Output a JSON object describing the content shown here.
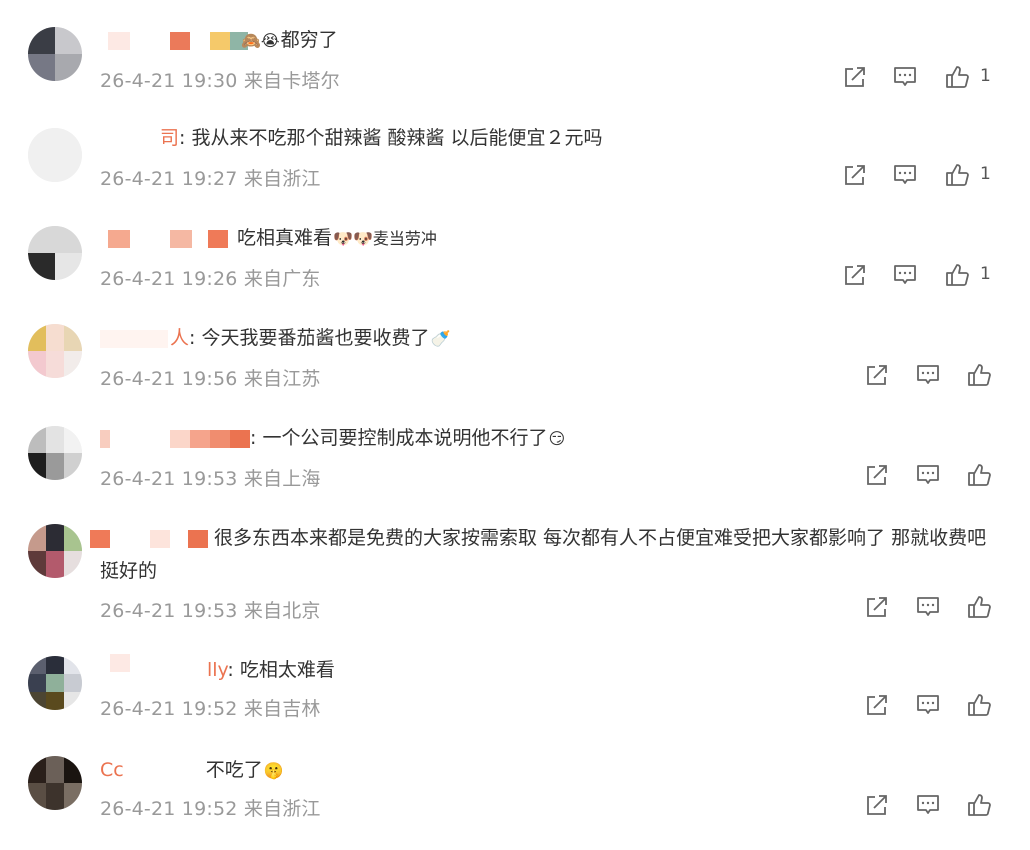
{
  "comments": [
    {
      "username": "",
      "text": "都穷了",
      "emoji_before": "🙈😭",
      "emoji_after": "",
      "time": "26-4-21 19:30",
      "location": "来自卡塔尔",
      "likes": "1"
    },
    {
      "username": "司",
      "text": "我从来不吃那个甜辣酱 酸辣酱 以后能便宜２元吗",
      "emoji_before": "",
      "emoji_after": "",
      "time": "26-4-21 19:27",
      "location": "来自浙江",
      "likes": "1"
    },
    {
      "username": "",
      "text": "吃相真难看",
      "emoji_before": "",
      "emoji_after": "🐶🐶麦当劳冲",
      "time": "26-4-21 19:26",
      "location": "来自广东",
      "likes": "1"
    },
    {
      "username": "人",
      "text": "今天我要番茄酱也要收费了",
      "emoji_before": "",
      "emoji_after": "🍼",
      "time": "26-4-21 19:56",
      "location": "来自江苏",
      "likes": ""
    },
    {
      "username": "",
      "text": "一个公司要控制成本说明他不行了",
      "emoji_before": "",
      "emoji_after": "😏",
      "time": "26-4-21 19:53",
      "location": "来自上海",
      "likes": ""
    },
    {
      "username": "",
      "text": "很多东西本来都是免费的大家按需索取 每次都有人不占便宜难受把大家都影响了 那就收费吧 挺好的",
      "emoji_before": "",
      "emoji_after": "",
      "time": "26-4-21 19:53",
      "location": "来自北京",
      "likes": ""
    },
    {
      "username": "lly",
      "text": "吃相太难看",
      "emoji_before": "",
      "emoji_after": "",
      "time": "26-4-21 19:52",
      "location": "来自吉林",
      "likes": ""
    },
    {
      "username": "Cc",
      "text": "不吃了",
      "emoji_before": "",
      "emoji_after": "🤫",
      "time": "26-4-21 19:52",
      "location": "来自浙江",
      "likes": ""
    }
  ],
  "icons": {
    "share": "share-icon",
    "comment": "comment-icon",
    "like": "like-icon"
  },
  "colors": {
    "username": "#eb7350",
    "text": "#333333",
    "meta": "#999999",
    "icon": "#666666"
  }
}
